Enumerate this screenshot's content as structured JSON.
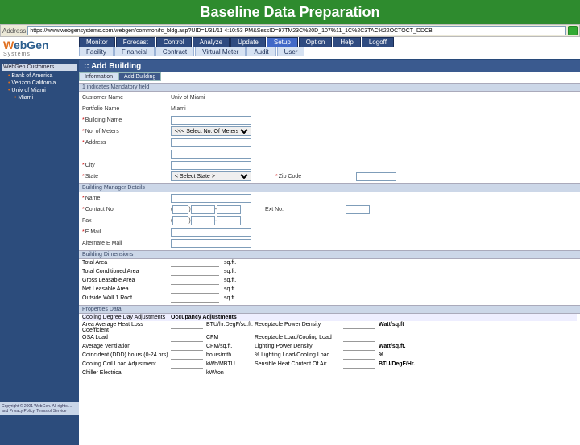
{
  "title": "Baseline Data Preparation",
  "addr": {
    "label": "Address",
    "value": "https://www.webgensystems.com/webgen/common/fc_bldg.asp?UID=1/31/11 4:10:53 PM&SessID=97TM23C%20D_107%11_1C%2C3TAC%22OCTOCT_DDCB"
  },
  "logo": {
    "brand": "WebGen",
    "brand_accent": "W",
    "sub": "Systems"
  },
  "nav1": [
    "Monitor",
    "Forecast",
    "Control",
    "Analyze",
    "Update",
    "Setup",
    "Option",
    "Help",
    "Logoff"
  ],
  "nav1_selected": 5,
  "nav2": [
    "Facility",
    "Financial",
    "Contract",
    "Virtual Meter",
    "Audit",
    "User"
  ],
  "sidebar": {
    "header": "WebGen Customers",
    "items": [
      "Bank of America",
      "Verizon California",
      "Univ of Miami"
    ],
    "sub": "Miami"
  },
  "breadcrumb": ":: Add Building",
  "subtabs": [
    "Information",
    "Add Building"
  ],
  "subtab_selected": 1,
  "sections": {
    "mandatory": "1 indicates Mandatory field",
    "bmgr": "Building Manager Details",
    "bdim": "Building Dimensions",
    "prop": "Properties Data"
  },
  "fields": {
    "customer": {
      "label": "Customer Name",
      "value": "Univ of Miami"
    },
    "portfolio": {
      "label": "Portfolio Name",
      "value": "Miami"
    },
    "building": {
      "label": "Building Name"
    },
    "meters": {
      "label": "No. of Meters",
      "placeholder": "<<< Select No. Of Meters>>>"
    },
    "address": {
      "label": "Address"
    },
    "city": {
      "label": "City"
    },
    "state": {
      "label": "State",
      "placeholder": "< Select State >"
    },
    "zip": {
      "label": "Zip Code"
    },
    "name": {
      "label": "Name"
    },
    "contact": {
      "label": "Contact No",
      "ext": "Ext No."
    },
    "fax": {
      "label": "Fax"
    },
    "email": {
      "label": "E Mail"
    },
    "altemail": {
      "label": "Alternate E Mail"
    }
  },
  "dims": [
    {
      "label": "Total Area",
      "unit": "sq.ft."
    },
    {
      "label": "Total Conditioned Area",
      "unit": "sq.ft."
    },
    {
      "label": "Gross Leasable Area",
      "unit": "sq.ft."
    },
    {
      "label": "Net Leasable Area",
      "unit": "sq.ft."
    },
    {
      "label": "Outside Wall 1 Roof",
      "unit": "sq.ft."
    }
  ],
  "prop_headers": {
    "left": "Cooling Degree Day Adjustments",
    "right": "Occupancy Adjustments"
  },
  "props": [
    {
      "l": "Area Average Heat Loss Coefficient",
      "lu": "BTU/hr.DegF/sq.ft.",
      "r": "Receptacle Power Density",
      "ru": "Watt/sq.ft"
    },
    {
      "l": "OSA Load",
      "lu": "CFM",
      "r": "Receptacle Load/Cooling Load",
      "ru": ""
    },
    {
      "l": "Average Ventilation",
      "lu": "CFM/sq.ft.",
      "r": "Lighting Power Density",
      "ru": "Watt/sq.ft."
    },
    {
      "l": "Coincident (DDD) hours (0-24 hrs)",
      "lu": "hours/mth",
      "r": "% Lighting Load/Cooling Load",
      "ru": "%"
    },
    {
      "l": "Cooling Coil Load Adjustment",
      "lu": "kWh/MBTU",
      "r": "Sensible Heat Content Of Air",
      "ru": "BTU/DegF/Hr."
    },
    {
      "l": "Chiller Electrical",
      "lu": "kW/ton",
      "r": "",
      "ru": ""
    }
  ],
  "copyright": "Copyright © 2001 WebGen. All rights ... and Privacy Policy, Terms of Service"
}
